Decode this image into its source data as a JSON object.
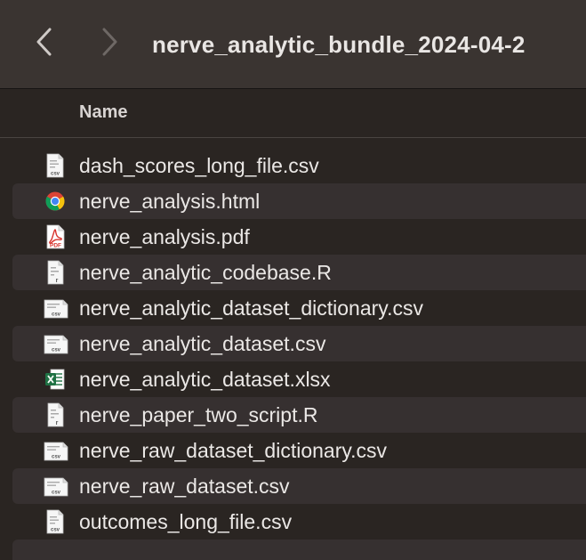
{
  "window": {
    "title": "nerve_analytic_bundle_2024-04-2"
  },
  "toolbar": {
    "back_icon": "chevron-left-icon",
    "forward_icon": "chevron-right-icon"
  },
  "columns": {
    "name": "Name"
  },
  "files": [
    {
      "name": "dash_scores_long_file.csv",
      "icon": "csv-file-icon",
      "type": "csv",
      "wide": false
    },
    {
      "name": "nerve_analysis.html",
      "icon": "chrome-html-icon",
      "type": "html",
      "wide": false
    },
    {
      "name": "nerve_analysis.pdf",
      "icon": "pdf-file-icon",
      "type": "pdf",
      "wide": false
    },
    {
      "name": "nerve_analytic_codebase.R",
      "icon": "r-file-icon",
      "type": "r",
      "wide": false
    },
    {
      "name": "nerve_analytic_dataset_dictionary.csv",
      "icon": "csv-file-icon",
      "type": "csv",
      "wide": true
    },
    {
      "name": "nerve_analytic_dataset.csv",
      "icon": "csv-file-icon",
      "type": "csv",
      "wide": true
    },
    {
      "name": "nerve_analytic_dataset.xlsx",
      "icon": "excel-file-icon",
      "type": "xlsx",
      "wide": false
    },
    {
      "name": "nerve_paper_two_script.R",
      "icon": "r-file-icon",
      "type": "r",
      "wide": false
    },
    {
      "name": "nerve_raw_dataset_dictionary.csv",
      "icon": "csv-file-icon",
      "type": "csv",
      "wide": true
    },
    {
      "name": "nerve_raw_dataset.csv",
      "icon": "csv-file-icon",
      "type": "csv",
      "wide": true
    },
    {
      "name": "outcomes_long_file.csv",
      "icon": "csv-file-icon",
      "type": "csv",
      "wide": false
    }
  ],
  "icon_text": {
    "csv": "csv",
    "pdf": "PDF",
    "r": "r"
  },
  "colors": {
    "toolbar_bg": "#3a3431",
    "list_bg": "#2a2522",
    "stripe_bg": "#363030",
    "text": "#ebe8e6",
    "pdf_red": "#d8322c",
    "excel_green": "#1f7244"
  }
}
